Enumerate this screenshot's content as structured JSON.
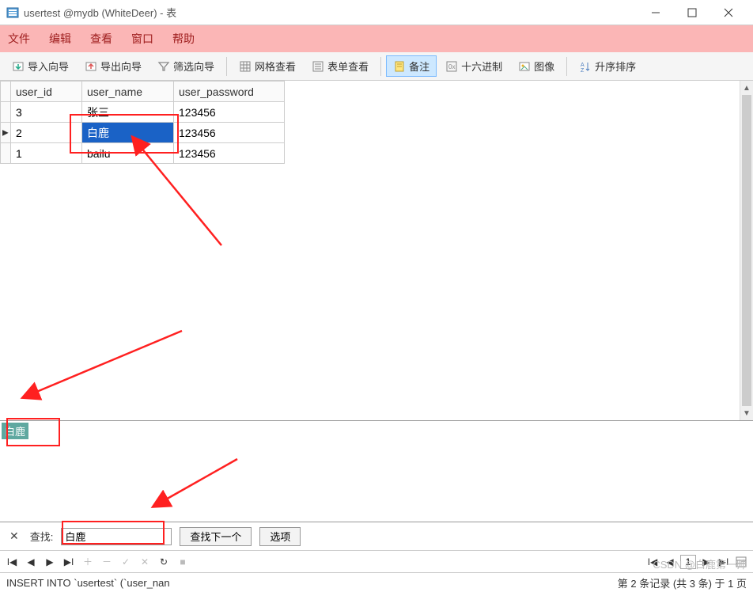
{
  "window": {
    "title": "usertest @mydb (WhiteDeer) - 表"
  },
  "menu": {
    "items": [
      "文件",
      "编辑",
      "查看",
      "窗口",
      "帮助"
    ]
  },
  "toolbar": {
    "import": "导入向导",
    "export": "导出向导",
    "filter": "筛选向导",
    "grid_view": "网格查看",
    "form_view": "表单查看",
    "note": "备注",
    "hex": "十六进制",
    "image": "图像",
    "sort_asc": "升序排序"
  },
  "table": {
    "columns": [
      "user_id",
      "user_name",
      "user_password"
    ],
    "rows": [
      {
        "user_id": "3",
        "user_name": "张三",
        "user_password": "123456",
        "selected": false
      },
      {
        "user_id": "2",
        "user_name": "白鹿",
        "user_password": "123456",
        "selected": true
      },
      {
        "user_id": "1",
        "user_name": "bailu",
        "user_password": "123456",
        "selected": false
      }
    ],
    "current_row_marker": "▶"
  },
  "detail": {
    "value": "白鹿"
  },
  "search": {
    "label": "查找:",
    "value": "白鹿",
    "find_next": "查找下一个",
    "options": "选项"
  },
  "nav": {
    "page_number": "1"
  },
  "status": {
    "sql": "INSERT INTO `usertest` (`user_nan",
    "page_info": "第 2 条记录 (共 3 条) 于 1 页"
  },
  "watermark": "CSDN @白鹿第一帅"
}
